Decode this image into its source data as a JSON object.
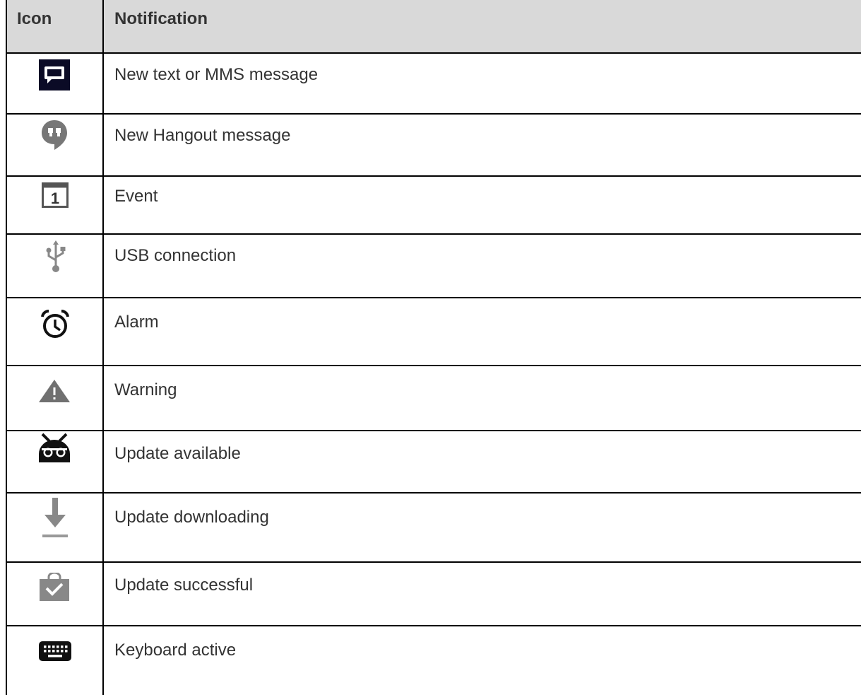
{
  "table": {
    "headers": {
      "icon": "Icon",
      "notification": "Notification"
    },
    "rows": [
      {
        "icon": "message-icon",
        "label": "New text or MMS message"
      },
      {
        "icon": "hangouts-icon",
        "label": "New Hangout message"
      },
      {
        "icon": "calendar-icon",
        "label": "Event"
      },
      {
        "icon": "usb-icon",
        "label": "USB connection"
      },
      {
        "icon": "alarm-clock-icon",
        "label": "Alarm"
      },
      {
        "icon": "warning-icon",
        "label": "Warning"
      },
      {
        "icon": "android-update-icon",
        "label": "Update available"
      },
      {
        "icon": "download-icon",
        "label": "Update downloading"
      },
      {
        "icon": "update-success-icon",
        "label": "Update successful"
      },
      {
        "icon": "keyboard-icon",
        "label": "Keyboard active"
      }
    ],
    "calendar_digit": "1"
  }
}
